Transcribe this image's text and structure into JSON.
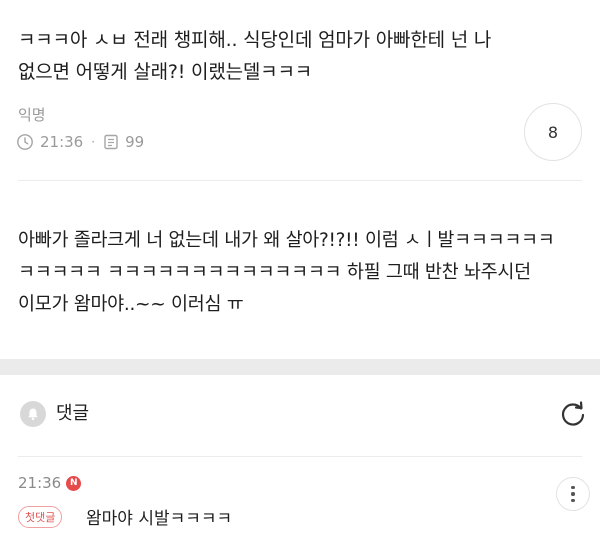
{
  "post": {
    "text_line1": "ㅋㅋㅋ아 ㅅㅂ 전래 챙피해.. 식당인데 엄마가 아빠한테 넌 나",
    "text_line2": "없으면 어떻게 살래?! 이랬는델ㅋㅋㅋ",
    "author": "익명",
    "time": "21:36",
    "views": "99",
    "comment_count": "8"
  },
  "reply": {
    "line1": "아빠가 졸라크게 너 없는데 내가 왜 살아?!?!! 이럼 ㅅㅣ발ㅋㅋㅋㅋㅋㅋ",
    "line2": "ㅋㅋㅋㅋㅋ ㅋㅋㅋㅋㅋㅋㅋㅋㅋㅋㅋㅋㅋㅋ 하필 그때 반찬 놔주시던",
    "line3": "이모가 왐마야..~~ 이러심 ㅠ"
  },
  "comments_section": {
    "title": "댓글"
  },
  "comment": {
    "time": "21:36",
    "new_badge": "N",
    "first_tag": "첫댓글",
    "text": "왐마야 시발ㅋㅋㅋㅋ"
  },
  "icons": {
    "clock": "clock-icon",
    "views": "document-icon",
    "bell": "bell-icon",
    "refresh": "refresh-icon",
    "more": "more-vertical-icon"
  },
  "colors": {
    "new_badge": "#e64a4a",
    "first_tag": "#e05454",
    "section_divider": "#ebebeb"
  }
}
